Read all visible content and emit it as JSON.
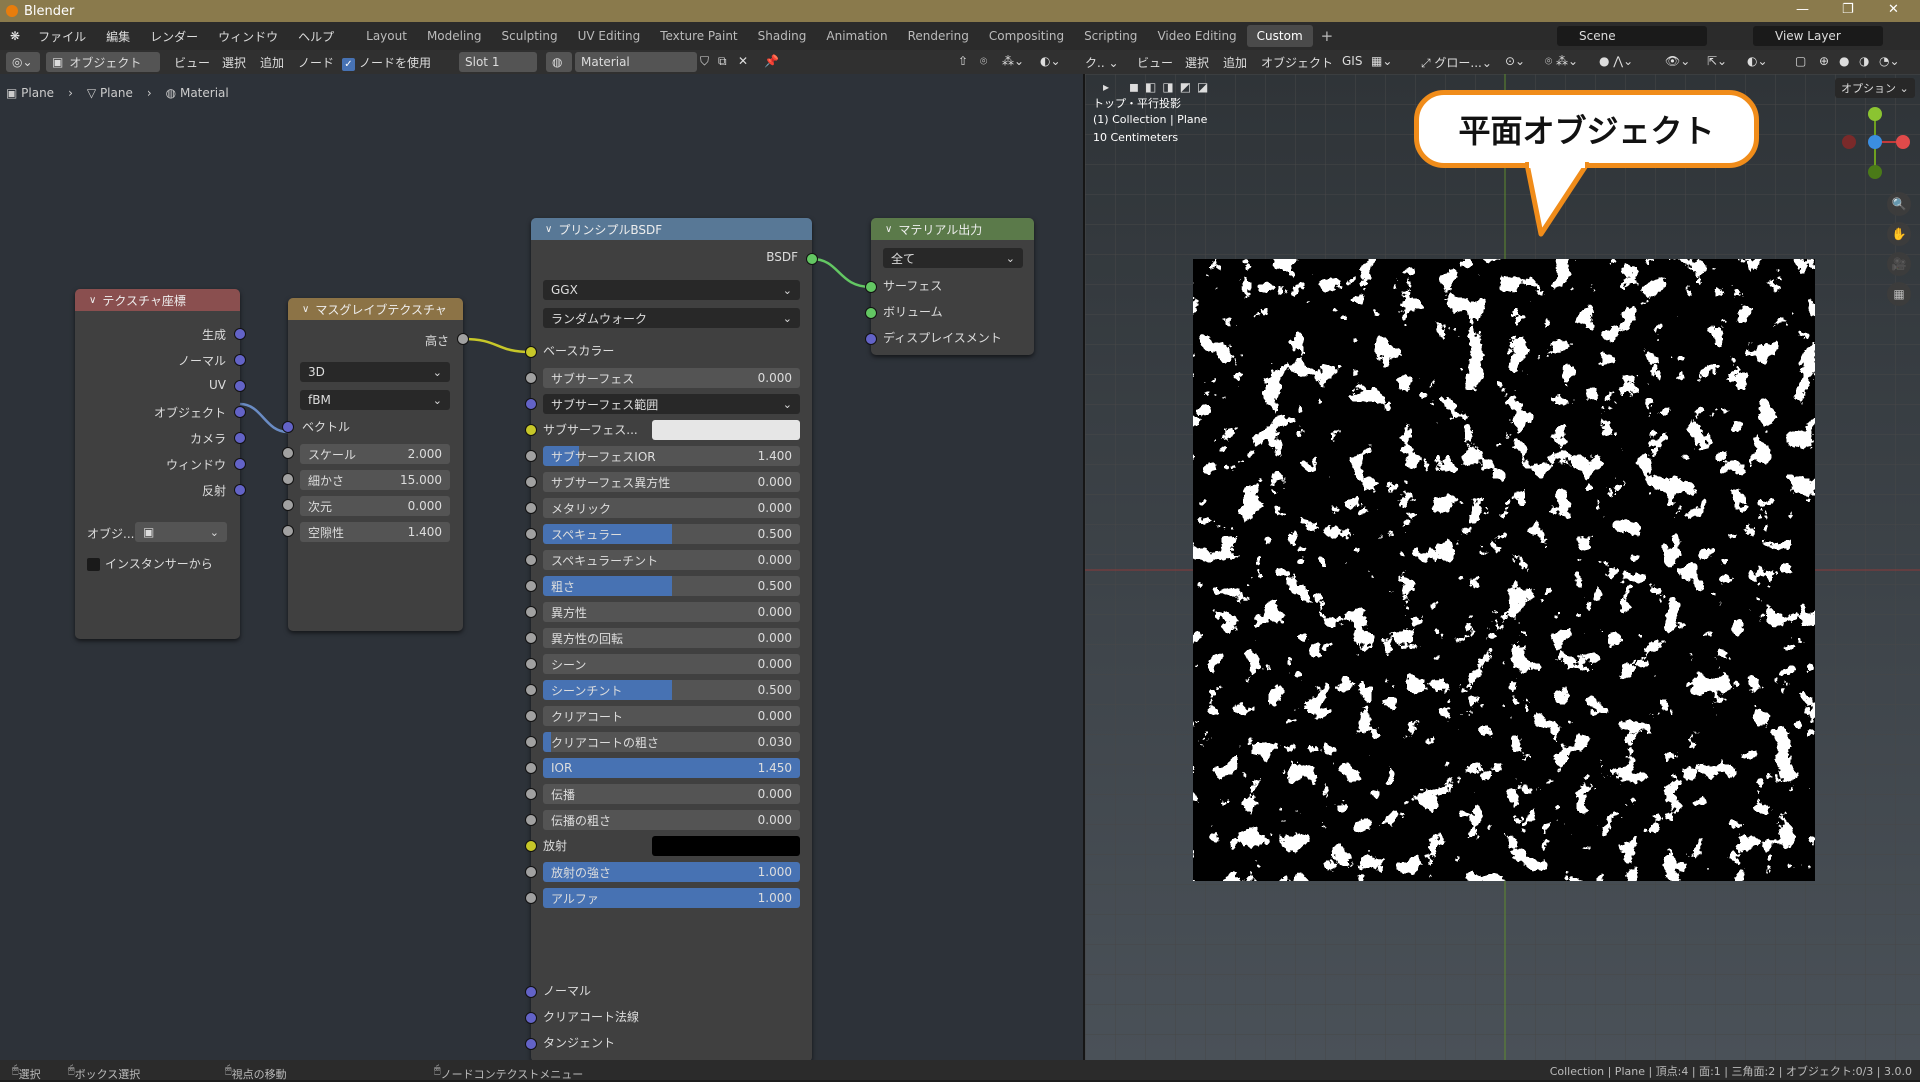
{
  "titlebar": {
    "title": "Blender"
  },
  "menus": [
    "ファイル",
    "編集",
    "レンダー",
    "ウィンドウ",
    "ヘルプ"
  ],
  "workspaces": [
    "Layout",
    "Modeling",
    "Sculpting",
    "UV Editing",
    "Texture Paint",
    "Shading",
    "Animation",
    "Rendering",
    "Compositing",
    "Scripting",
    "Video Editing",
    "Custom"
  ],
  "active_workspace": "Custom",
  "scene": "Scene",
  "view_layer": "View Layer",
  "node_header": {
    "mode": "オブジェクト",
    "view": "ビュー",
    "select": "選択",
    "add": "追加",
    "node": "ノード",
    "use_nodes": "ノードを使用",
    "slot": "Slot 1",
    "material": "Material"
  },
  "breadcrumb": [
    "Plane",
    "Plane",
    "Material"
  ],
  "tex_coord": {
    "title": "テクスチャ座標",
    "outputs": [
      "生成",
      "ノーマル",
      "UV",
      "オブジェクト",
      "カメラ",
      "ウィンドウ",
      "反射"
    ],
    "object_label": "オブジ...",
    "from_instancer": "インスタンサーから"
  },
  "musgrave": {
    "title": "マスグレイブテクスチャ",
    "output": "高さ",
    "dim": "3D",
    "type": "fBM",
    "vector": "ベクトル",
    "params": [
      {
        "label": "スケール",
        "value": "2.000"
      },
      {
        "label": "細かさ",
        "value": "15.000"
      },
      {
        "label": "次元",
        "value": "0.000"
      },
      {
        "label": "空隙性",
        "value": "1.400"
      }
    ]
  },
  "bsdf": {
    "title": "プリンシプルBSDF",
    "output": "BSDF",
    "distribution": "GGX",
    "subsurface_method": "ランダムウォーク",
    "base_color": "ベースカラー",
    "rows": [
      {
        "label": "サブサーフェス",
        "value": "0.000",
        "fill": 0
      },
      {
        "label": "サブサーフェス範囲",
        "value": "",
        "fill": 0,
        "dd": true
      },
      {
        "label": "サブサーフェス...",
        "value": "",
        "fill": 0,
        "color": "#e6e6e6"
      },
      {
        "label": "サブサーフェスIOR",
        "value": "1.400",
        "fill": 0.14
      },
      {
        "label": "サブサーフェス異方性",
        "value": "0.000",
        "fill": 0
      },
      {
        "label": "メタリック",
        "value": "0.000",
        "fill": 0
      },
      {
        "label": "スペキュラー",
        "value": "0.500",
        "fill": 0.5
      },
      {
        "label": "スペキュラーチント",
        "value": "0.000",
        "fill": 0
      },
      {
        "label": "粗さ",
        "value": "0.500",
        "fill": 0.5
      },
      {
        "label": "異方性",
        "value": "0.000",
        "fill": 0
      },
      {
        "label": "異方性の回転",
        "value": "0.000",
        "fill": 0
      },
      {
        "label": "シーン",
        "value": "0.000",
        "fill": 0
      },
      {
        "label": "シーンチント",
        "value": "0.500",
        "fill": 0.5
      },
      {
        "label": "クリアコート",
        "value": "0.000",
        "fill": 0
      },
      {
        "label": "クリアコートの粗さ",
        "value": "0.030",
        "fill": 0.03
      },
      {
        "label": "IOR",
        "value": "1.450",
        "fill": 1
      },
      {
        "label": "伝播",
        "value": "0.000",
        "fill": 0
      },
      {
        "label": "伝播の粗さ",
        "value": "0.000",
        "fill": 0
      },
      {
        "label": "放射",
        "value": "",
        "fill": 0,
        "color": "#000000"
      },
      {
        "label": "放射の強さ",
        "value": "1.000",
        "fill": 1
      },
      {
        "label": "アルファ",
        "value": "1.000",
        "fill": 1
      }
    ],
    "inputs_bottom": [
      "ノーマル",
      "クリアコート法線",
      "タンジェント"
    ]
  },
  "material_output": {
    "title": "マテリアル出力",
    "target": "全て",
    "inputs": [
      "サーフェス",
      "ボリューム",
      "ディスプレイスメント"
    ]
  },
  "viewport": {
    "menus": [
      "ビュー",
      "選択",
      "追加",
      "オブジェクト",
      "GIS"
    ],
    "glow": "グロー...",
    "options": "オプション",
    "info": [
      "トップ・平行投影",
      "(1) Collection | Plane",
      "10 Centimeters"
    ],
    "callout": "平面オブジェクト"
  },
  "status": {
    "select": "選択",
    "box_select": "ボックス選択",
    "move_view": "視点の移動",
    "node_context": "ノードコンテクストメニュー",
    "stats": "Collection | Plane | 頂点:4 | 面:1 | 三角面:2 | オブジェクト:0/3 | 3.0.0"
  }
}
